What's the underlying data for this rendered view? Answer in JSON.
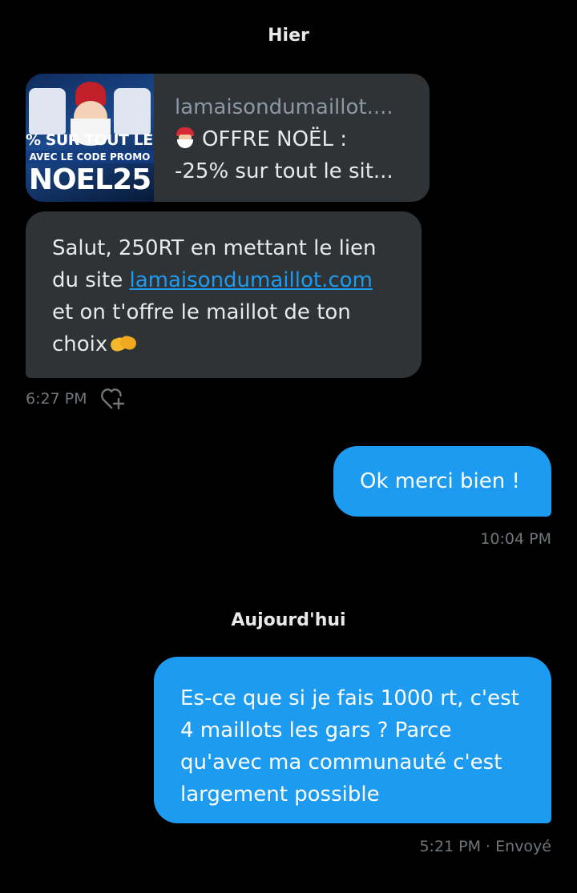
{
  "separators": {
    "yesterday": "Hier",
    "today": "Aujourd'hui"
  },
  "link_preview": {
    "domain": "lamaisondumaillot....",
    "title": "OFFRE NOËL :",
    "description": "-25% sur tout le sit...",
    "title_emoji": "santa-emoji",
    "thumbnail": {
      "line1": "% SUR TOUT LE S",
      "line2": "AVEC LE CODE PROMO",
      "line3": "NOEL25"
    }
  },
  "messages": {
    "incoming": {
      "text_before": "Salut, 250RT en mettant le lien du site ",
      "link": "lamaisondumaillot.com",
      "text_after": " et on t'offre le maillot de ton choix",
      "emoji": "handshake-emoji",
      "time": "6:27 PM",
      "reaction_icon": "add-reaction-icon"
    },
    "outgoing1": {
      "text": "Ok merci bien !",
      "time": "10:04 PM"
    },
    "outgoing2": {
      "text": "Es-ce que si je fais 1000 rt, c'est 4 maillots les gars ? Parce qu'avec ma communauté c'est largement possible",
      "time": "5:21 PM",
      "status": "Envoyé",
      "separator": " · "
    }
  },
  "colors": {
    "background": "#000000",
    "incoming_bubble": "#2f3336",
    "outgoing_bubble": "#1d9bf0",
    "link": "#1d9bf0",
    "meta_text": "#71767b"
  }
}
